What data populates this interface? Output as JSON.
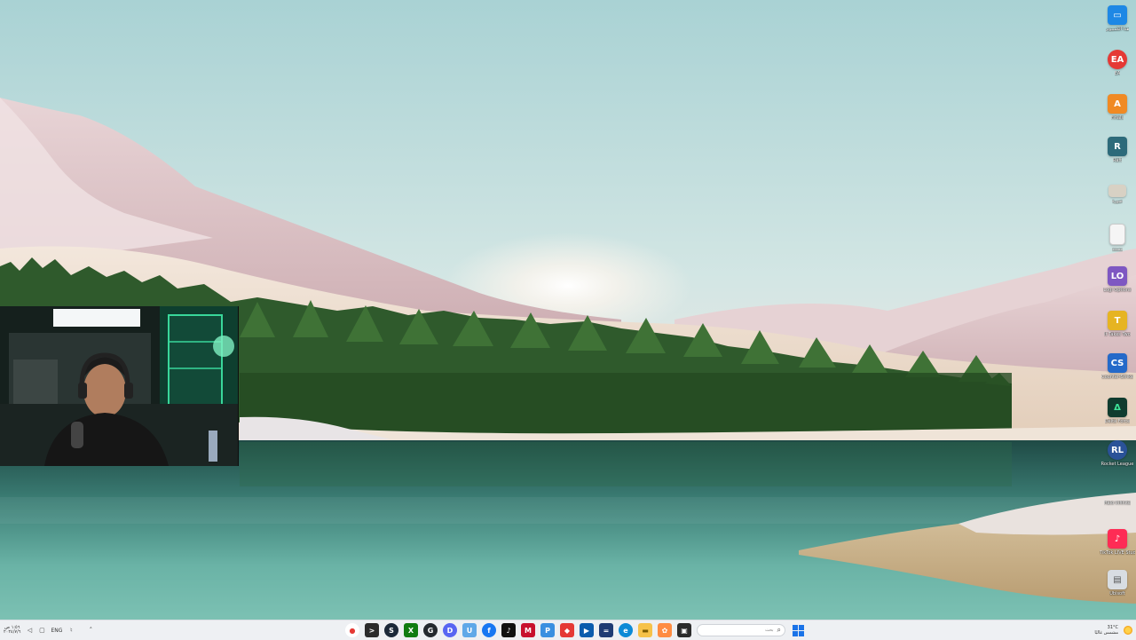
{
  "desktop": {
    "icons": [
      {
        "name": "monitor-icon",
        "label": "هذا الكمبيوتر",
        "color": "#1e88e5",
        "glyph": ""
      },
      {
        "name": "ea-icon",
        "label": "EA",
        "color": "#e53935",
        "glyph": "EA"
      },
      {
        "name": "finals-icon",
        "label": "Finals",
        "color": "#f08a24",
        "glyph": "A"
      },
      {
        "name": "raft-icon",
        "label": "Raft",
        "color": "#2d6a7a",
        "glyph": "R"
      },
      {
        "name": "image-file-icon",
        "label": "صورة",
        "color": "#d8d1c4",
        "glyph": ""
      },
      {
        "name": "document-icon",
        "label": "مستند",
        "color": "#f5f5f5",
        "glyph": ""
      },
      {
        "name": "logi-options-icon",
        "label": "Logi Options",
        "color": "#7e57c2",
        "glyph": "LO"
      },
      {
        "name": "game-icon",
        "label": "It Takes Two",
        "color": "#e6b422",
        "glyph": "T"
      },
      {
        "name": "counter-strike-icon",
        "label": "Counter-Strike",
        "color": "#2469c9",
        "glyph": "CS"
      },
      {
        "name": "delta-force-icon",
        "label": "Delta Force",
        "color": "#0f3b2e",
        "glyph": "Δ"
      },
      {
        "name": "rocket-league-icon",
        "label": "Rocket League",
        "color": "#2a5298",
        "glyph": "RL"
      },
      {
        "name": "game-shortcut-icon",
        "label": "Halo Infinite",
        "color": "#f0f0f0",
        "glyph": ""
      },
      {
        "name": "tiktok-live-studio-icon",
        "label": "TikTok LIVE Studio",
        "color": "#fe2c55",
        "glyph": "♪"
      },
      {
        "name": "app-shortcut-icon",
        "label": "Ubisoft",
        "color": "#d8dde2",
        "glyph": ""
      }
    ]
  },
  "taskbar": {
    "left": {
      "keyboard_lang": "ENG",
      "widget_time_line1": "١:٥٦ ص",
      "widget_time_line2": "٢٠٢٤/٧/٦"
    },
    "apps": [
      {
        "name": "chrome-icon",
        "color": "#ffffff",
        "glyph": "●"
      },
      {
        "name": "terminal-icon",
        "color": "#2b2b2b",
        "glyph": ">"
      },
      {
        "name": "steam-icon",
        "color": "#1b2838",
        "glyph": "S"
      },
      {
        "name": "xbox-icon",
        "color": "#107c10",
        "glyph": "X"
      },
      {
        "name": "github-icon",
        "color": "#24292e",
        "glyph": "G"
      },
      {
        "name": "discord-icon",
        "color": "#5865f2",
        "glyph": "D"
      },
      {
        "name": "shield-icon",
        "color": "#5fa8e8",
        "glyph": "U"
      },
      {
        "name": "facebook-icon",
        "color": "#1877f2",
        "glyph": "f"
      },
      {
        "name": "tiktok-icon",
        "color": "#111111",
        "glyph": "♪"
      },
      {
        "name": "mcafee-icon",
        "color": "#c8102e",
        "glyph": "M"
      },
      {
        "name": "paint-icon",
        "color": "#3a8fe0",
        "glyph": "P"
      },
      {
        "name": "red-app-icon",
        "color": "#e53935",
        "glyph": "◆"
      },
      {
        "name": "media-icon",
        "color": "#0b5cad",
        "glyph": "▶"
      },
      {
        "name": "calculator-icon",
        "color": "#1f3b73",
        "glyph": "="
      },
      {
        "name": "edge-icon",
        "color": "#0c8ad6",
        "glyph": "e"
      },
      {
        "name": "file-explorer-icon",
        "color": "#f6c24a",
        "glyph": "▬"
      },
      {
        "name": "photos-icon",
        "color": "#ff8c42",
        "glyph": "✿"
      },
      {
        "name": "app-icon",
        "color": "#2b2b2b",
        "glyph": "▣"
      }
    ],
    "search_placeholder": "بحث",
    "right": {
      "temperature": "31°C",
      "weather_text": "مشمس غالبًا"
    }
  }
}
